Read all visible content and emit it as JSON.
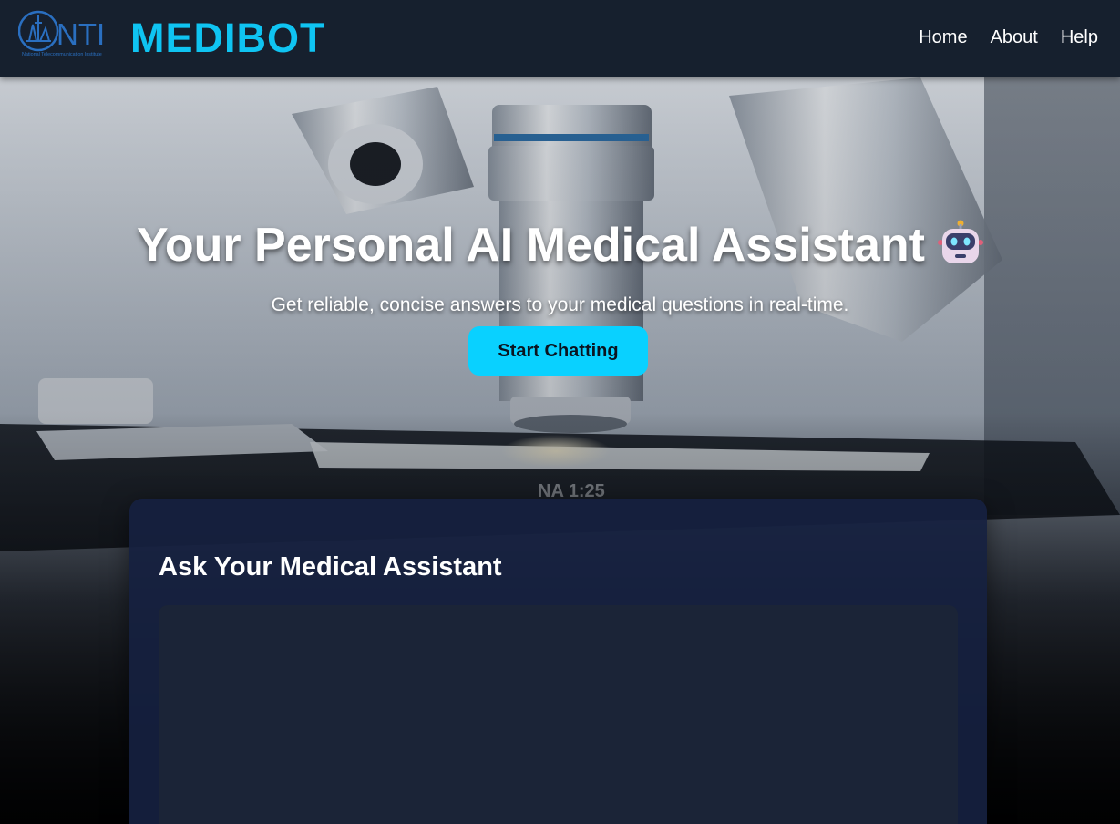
{
  "header": {
    "logo_text": "NTI",
    "logo_subtext": "National Telecommunication Institute",
    "brand": "MEDIBOT",
    "nav": [
      {
        "label": "Home"
      },
      {
        "label": "About"
      },
      {
        "label": "Help"
      }
    ]
  },
  "hero": {
    "title": "Your Personal AI Medical Assistant",
    "title_icon": "robot-icon",
    "subtitle": "Get reliable, concise answers to your medical questions in real-time.",
    "cta_label": "Start Chatting",
    "background_image": "microscope-photo"
  },
  "chat": {
    "title": "Ask Your Medical Assistant",
    "messages": []
  },
  "colors": {
    "accent": "#0fc4f2",
    "cta": "#09d1ff",
    "header_bg": "#16202e",
    "card_bg": "#162040",
    "chat_box_bg": "#1b2437"
  }
}
